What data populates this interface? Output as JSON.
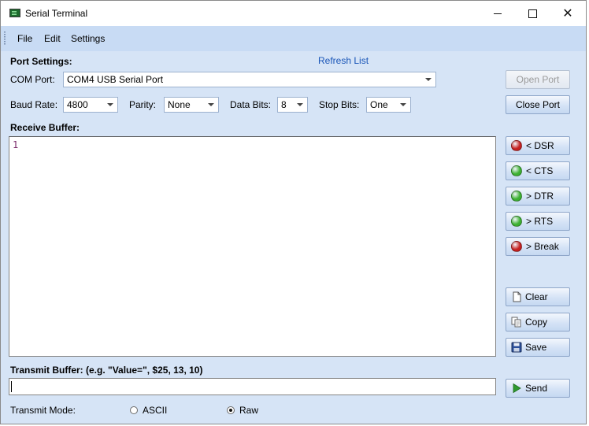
{
  "window": {
    "title": "Serial Terminal",
    "controls": {
      "minimize": "minimize",
      "maximize": "maximize",
      "close": "✕"
    }
  },
  "menu": {
    "items": [
      "File",
      "Edit",
      "Settings"
    ]
  },
  "port_settings": {
    "heading": "Port Settings:",
    "refresh_link": "Refresh List",
    "com_port_label": "COM Port:",
    "com_port_value": "COM4 USB Serial Port",
    "baud_rate_label": "Baud Rate:",
    "baud_rate_value": "4800",
    "parity_label": "Parity:",
    "parity_value": "None",
    "data_bits_label": "Data Bits:",
    "data_bits_value": "8",
    "stop_bits_label": "Stop Bits:",
    "stop_bits_value": "One"
  },
  "buttons": {
    "open_port": "Open Port",
    "close_port": "Close Port",
    "dsr": "< DSR",
    "cts": "< CTS",
    "dtr": "> DTR",
    "rts": "> RTS",
    "break": "> Break",
    "clear": "Clear",
    "copy": "Copy",
    "save": "Save",
    "send": "Send"
  },
  "signals": {
    "dsr": "red",
    "cts": "green",
    "dtr": "green",
    "rts": "green",
    "break": "red"
  },
  "colors": {
    "led_red": "#c62020",
    "led_green": "#3cb131",
    "link": "#1a56b8",
    "window_bg": "#d6e4f6"
  },
  "receive": {
    "heading": "Receive Buffer:",
    "content": "1"
  },
  "transmit": {
    "heading": "Transmit Buffer: (e.g. \"Value=\", $25, 13, 10)",
    "value": "",
    "mode_label": "Transmit Mode:",
    "modes": [
      "ASCII",
      "Raw"
    ],
    "selected_mode": "Raw"
  }
}
